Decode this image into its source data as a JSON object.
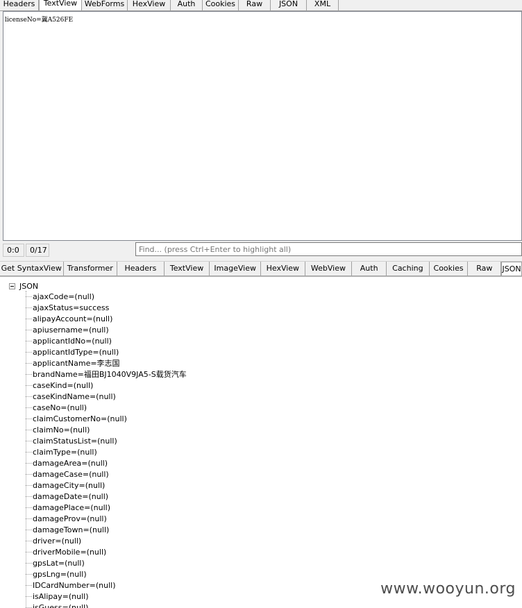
{
  "request_tabs": [
    "Headers",
    "TextView",
    "WebForms",
    "HexView",
    "Auth",
    "Cookies",
    "Raw",
    "JSON",
    "XML"
  ],
  "request_active_tab": "TextView",
  "request_body": "licenseNo=冀A526FE",
  "status": {
    "position": "0:0",
    "count": "0/17",
    "find_placeholder": "Find... (press Ctrl+Enter to highlight all)"
  },
  "response_tabs": [
    "Get SyntaxView",
    "Transformer",
    "Headers",
    "TextView",
    "ImageView",
    "HexView",
    "WebView",
    "Auth",
    "Caching",
    "Cookies",
    "Raw",
    "JSON"
  ],
  "response_active_tab": "JSON",
  "tree": {
    "root": "JSON",
    "items": [
      "ajaxCode=(null)",
      "ajaxStatus=success",
      "alipayAccount=(null)",
      "apiusername=(null)",
      "applicantIdNo=(null)",
      "applicantIdType=(null)",
      "applicantName=李志国",
      "brandName=福田BJ1040V9JA5-S载货汽车",
      "caseKind=(null)",
      "caseKindName=(null)",
      "caseNo=(null)",
      "claimCustomerNo=(null)",
      "claimNo=(null)",
      "claimStatusList=(null)",
      "claimType=(null)",
      "damageArea=(null)",
      "damageCase=(null)",
      "damageCity=(null)",
      "damageDate=(null)",
      "damagePlace=(null)",
      "damageProv=(null)",
      "damageTown=(null)",
      "driver=(null)",
      "driverMobile=(null)",
      "gpsLat=(null)",
      "gpsLng=(null)",
      "IDCardNumber=(null)",
      "isAlipay=(null)",
      "isGuess=(null)"
    ]
  },
  "watermark": "www.wooyun.org"
}
